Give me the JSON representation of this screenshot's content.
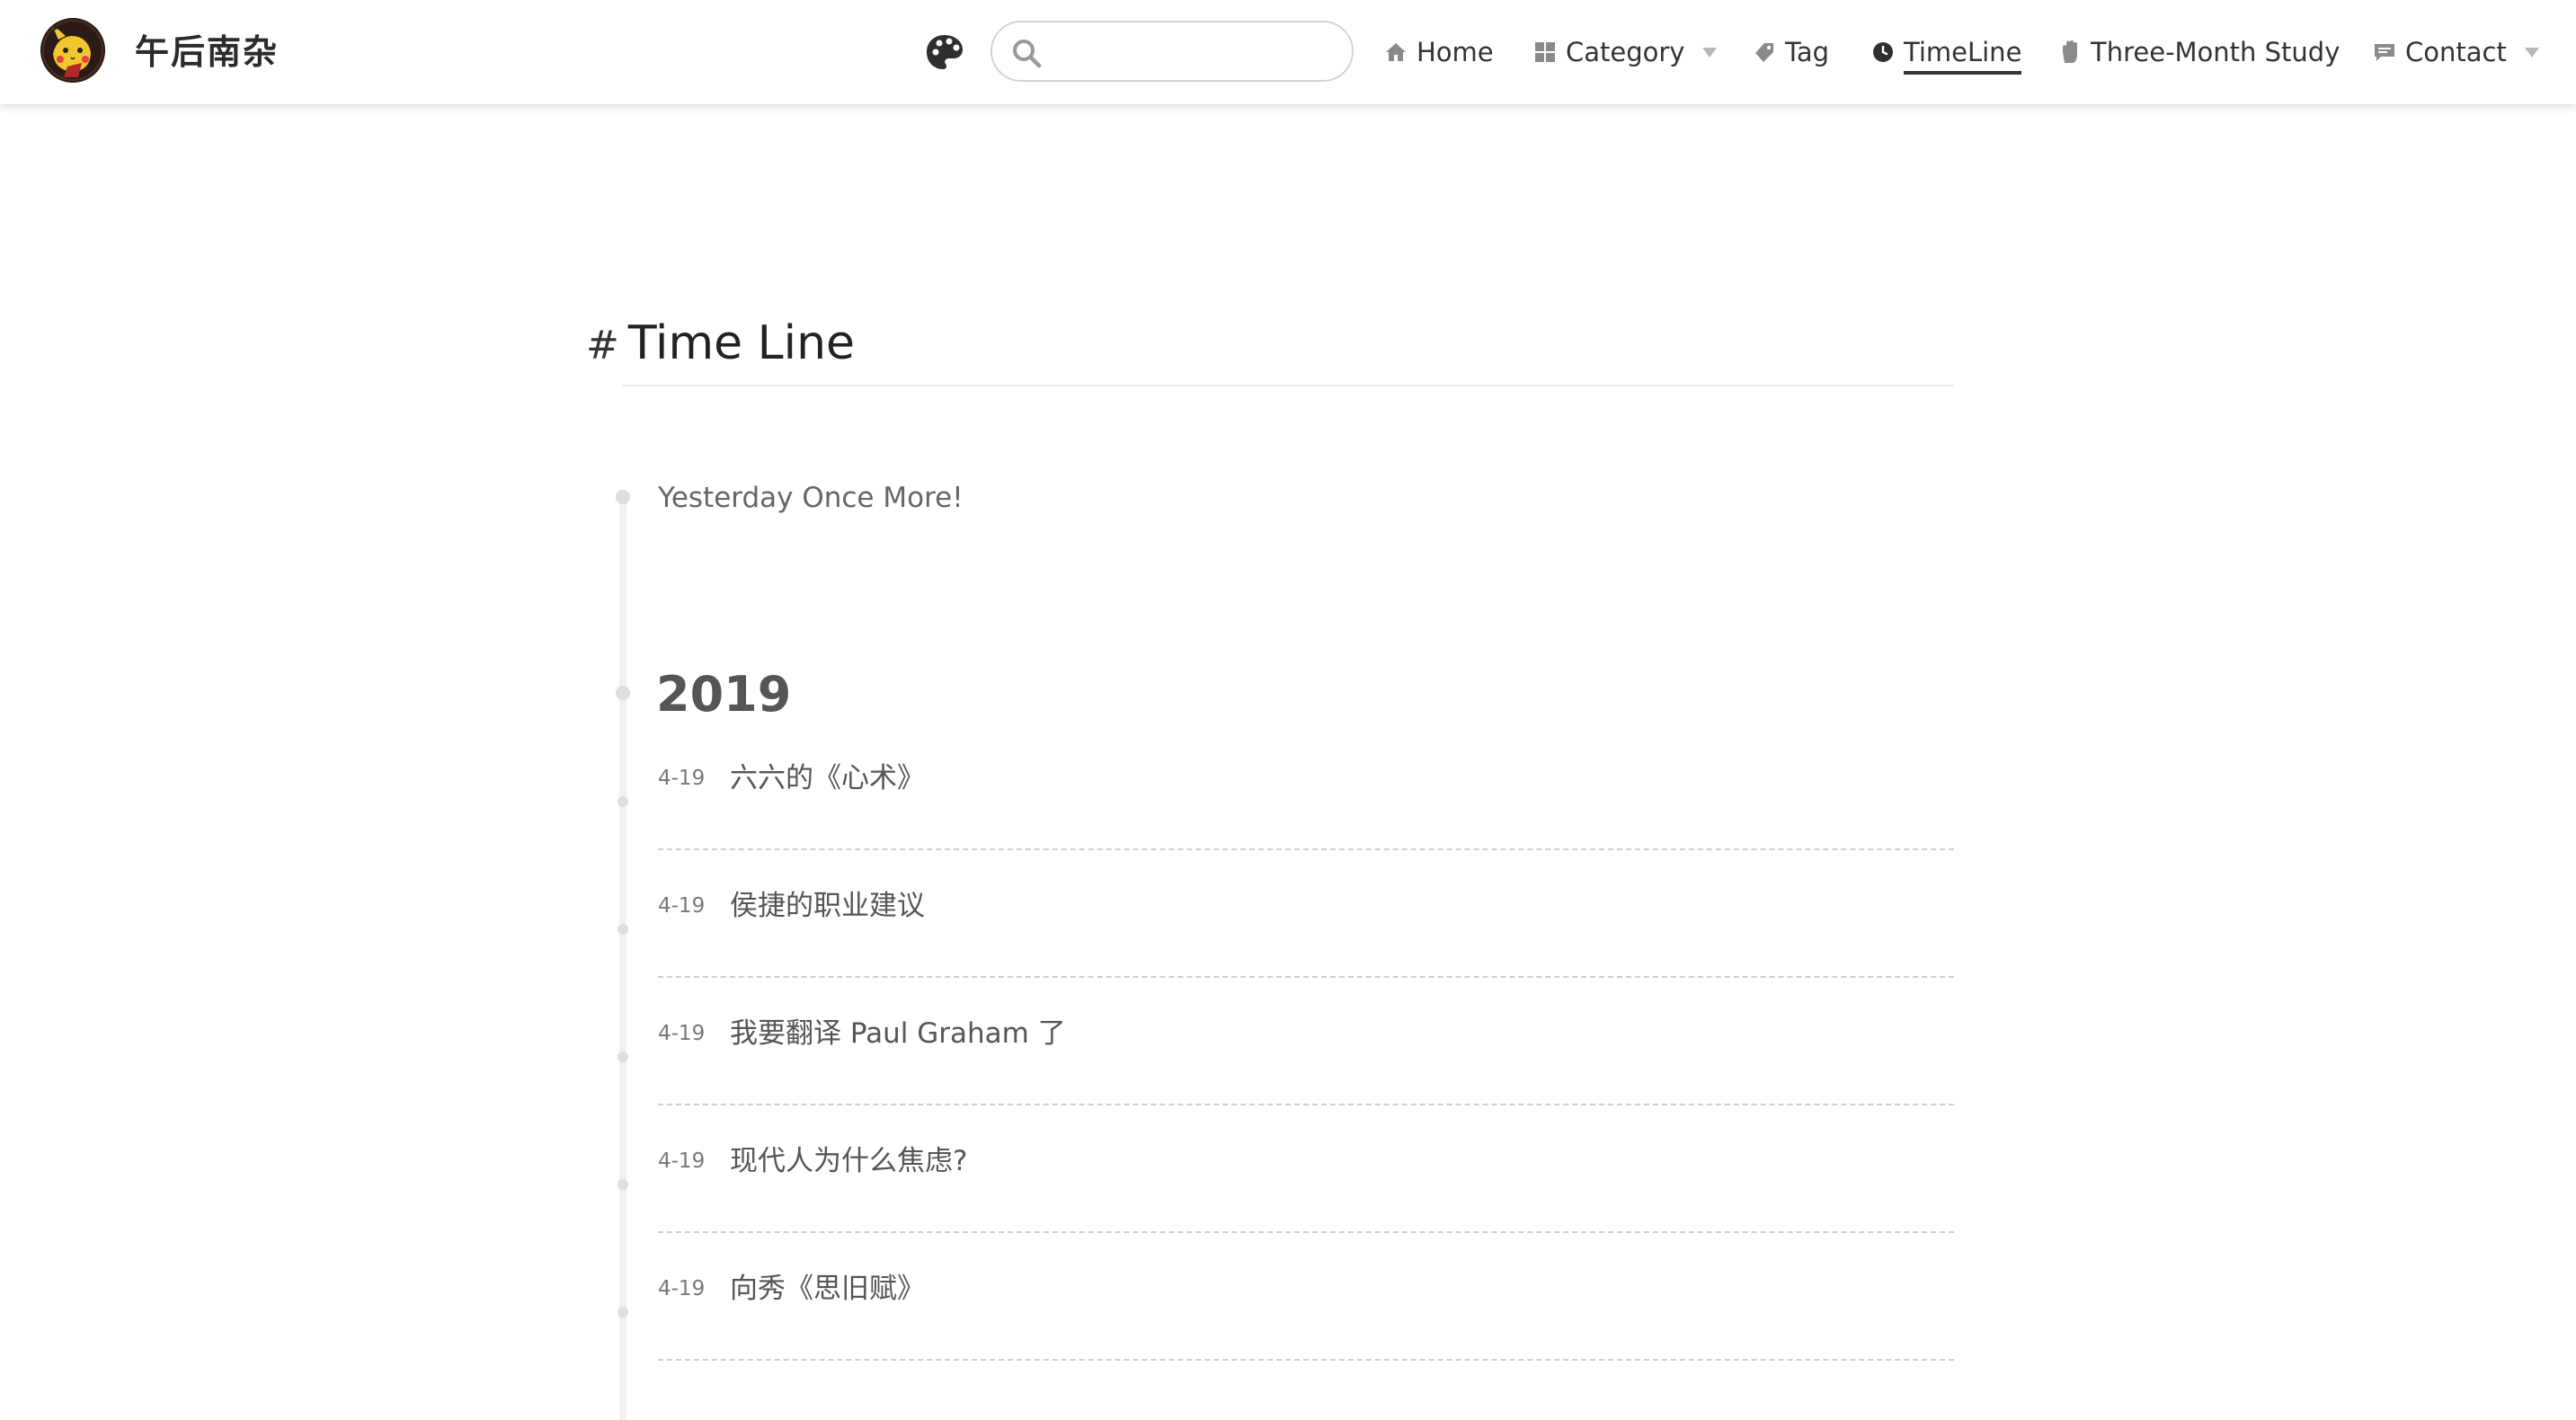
{
  "site": {
    "title": "午后南杂"
  },
  "search": {
    "placeholder": ""
  },
  "nav": {
    "home": "Home",
    "category": "Category",
    "tag": "Tag",
    "timeline": "TimeLine",
    "study": "Three-Month Study",
    "contact": "Contact"
  },
  "page": {
    "hash": "#",
    "title": "Time Line",
    "tagline": "Yesterday Once More!",
    "year": "2019"
  },
  "posts": [
    {
      "date": "4-19",
      "title": "六六的《心术》"
    },
    {
      "date": "4-19",
      "title": "侯捷的职业建议"
    },
    {
      "date": "4-19",
      "title": "我要翻译 Paul Graham 了"
    },
    {
      "date": "4-19",
      "title": "现代人为什么焦虑?"
    },
    {
      "date": "4-19",
      "title": "向秀《思旧赋》"
    }
  ],
  "colors": {
    "text": "#333333",
    "muted": "#777777",
    "timeline": "#f1f1f1",
    "dot": "#dedede",
    "divider": "#cfcfcf"
  },
  "icons": [
    "palette-icon",
    "search-icon",
    "home-icon",
    "grid-icon",
    "tag-icon",
    "clock-icon",
    "hand-icon",
    "message-icon"
  ]
}
